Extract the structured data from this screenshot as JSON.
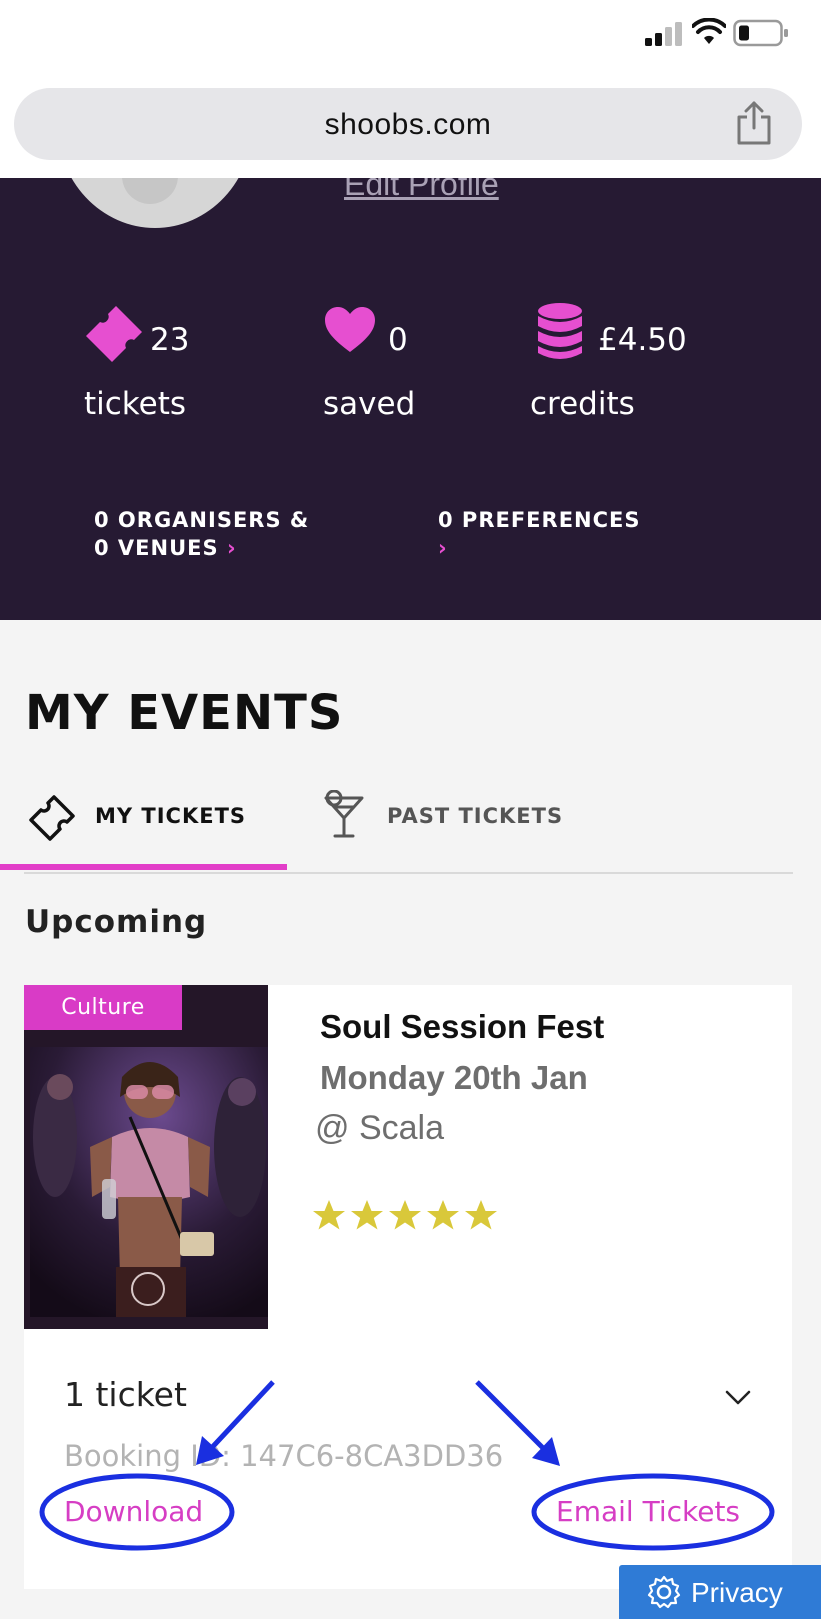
{
  "browser": {
    "url": "shoobs.com"
  },
  "profile": {
    "edit_profile": "Edit Profile",
    "stats": {
      "tickets_count": "23",
      "tickets_label": "tickets",
      "saved_count": "0",
      "saved_label": "saved",
      "credits_amount": "£4.50",
      "credits_label": "credits"
    },
    "links": {
      "organisers_line1": "0 ORGANISERS &",
      "organisers_line2": "0 VENUES",
      "preferences": "0 PREFERENCES"
    }
  },
  "my_events": {
    "title": "MY EVENTS",
    "tabs": {
      "my_tickets": "MY TICKETS",
      "past_tickets": "PAST TICKETS"
    },
    "section": "Upcoming"
  },
  "event": {
    "category": "Culture",
    "title": "Soul Session Fest",
    "date": "Monday 20th Jan",
    "venue": "@ Scala",
    "rating": 5,
    "ticket_count": "1 ticket",
    "booking_id": "Booking ID: 147C6-8CA3DD36",
    "download_label": "Download",
    "email_label": "Email Tickets"
  },
  "privacy_label": "Privacy",
  "colors": {
    "header_bg": "#261a33",
    "accent_pink": "#e23dc8",
    "annotation_blue": "#1a2fe0",
    "privacy_blue": "#2f7bd6"
  }
}
